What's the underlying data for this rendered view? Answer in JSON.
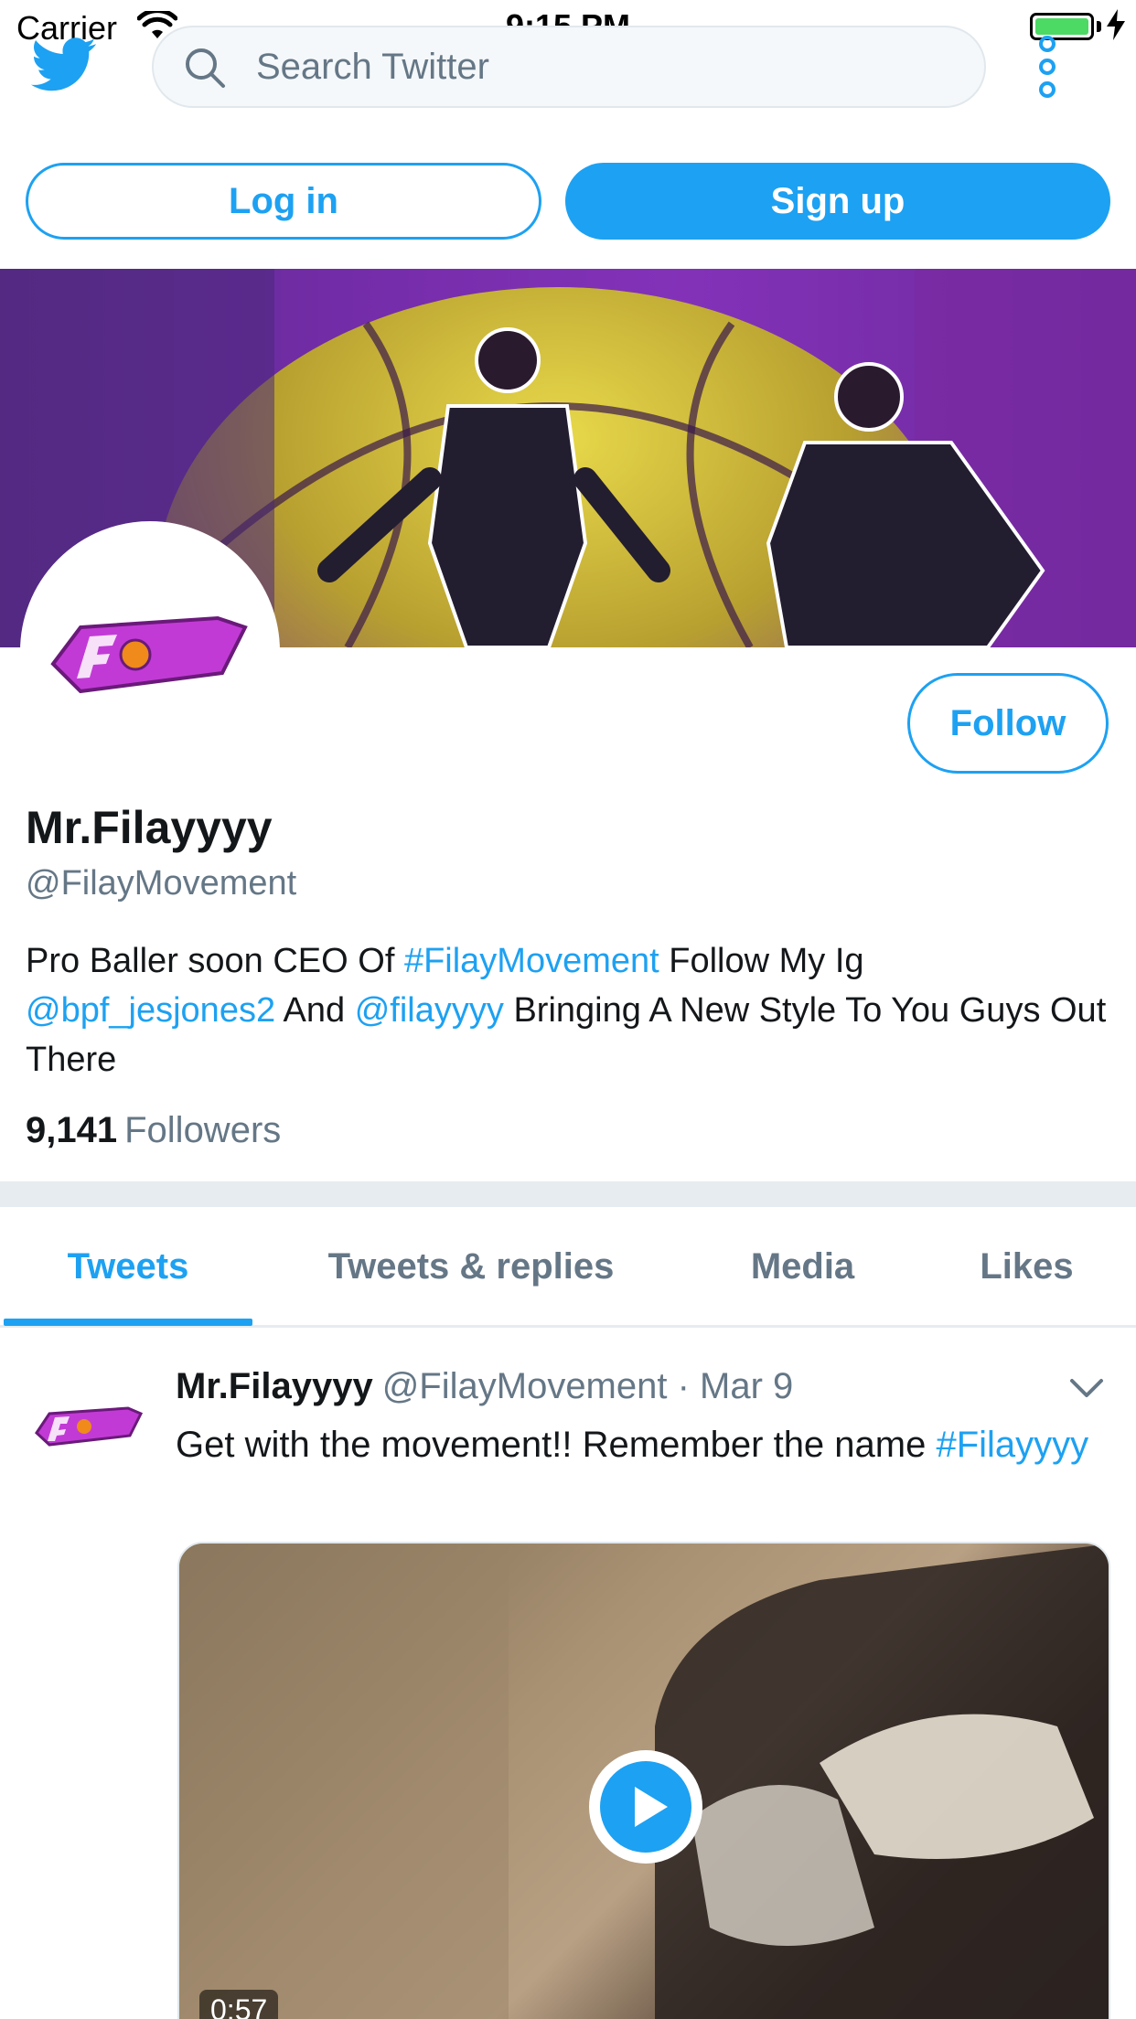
{
  "status_bar": {
    "carrier": "Carrier",
    "time": "9:15 PM",
    "battery_color": "#4cd964"
  },
  "header": {
    "logo_icon": "twitter-bird-icon",
    "search_placeholder": "Search Twitter",
    "more_icon": "vertical-dots-icon"
  },
  "auth": {
    "login_label": "Log in",
    "signup_label": "Sign up"
  },
  "profile": {
    "display_name": "Mr.Filayyyy",
    "handle": "@FilayMovement",
    "follow_label": "Follow",
    "bio": {
      "t1": "Pro Baller soon CEO Of ",
      "link1": "#FilayMovement",
      "t2": " Follow My Ig ",
      "link2": "@bpf_jesjones2",
      "t3": " And ",
      "link3": "@filayyyy",
      "t4": " Bringing A New Style To You Guys Out There"
    },
    "followers_count": "9,141",
    "followers_label": "Followers"
  },
  "tabs": [
    {
      "label": "Tweets",
      "active": true
    },
    {
      "label": "Tweets & replies",
      "active": false
    },
    {
      "label": "Media",
      "active": false
    },
    {
      "label": "Likes",
      "active": false
    }
  ],
  "tweet": {
    "name": "Mr.Filayyyy",
    "meta": "@FilayMovement · Mar 9",
    "text": "Get with the movement!! Remember the name ",
    "hashtag": "#Filayyyy",
    "video_duration": "0:57"
  },
  "colors": {
    "accent": "#1da1f2",
    "secondary_text": "#657786",
    "primary_text": "#14171a",
    "divider": "#e6ecf0"
  }
}
